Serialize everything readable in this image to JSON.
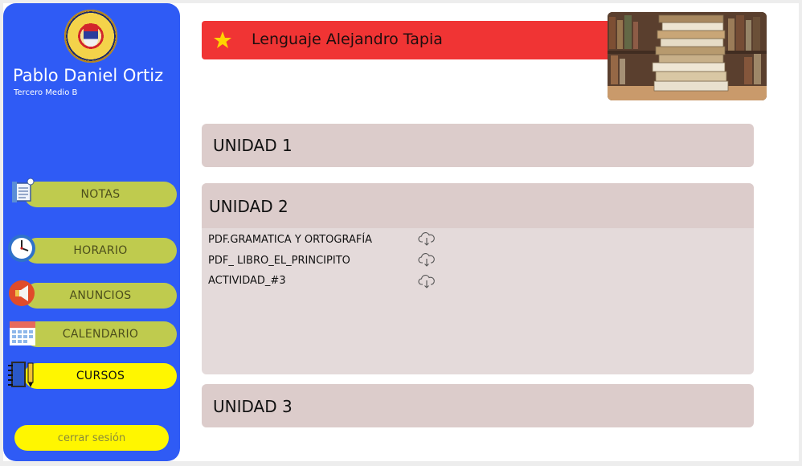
{
  "sidebar": {
    "user_name": "Pablo Daniel Ortiz",
    "user_grade": "Tercero Medio B",
    "nav": [
      {
        "label": "NOTAS",
        "icon": "notes-icon"
      },
      {
        "label": "HORARIO",
        "icon": "clock-icon"
      },
      {
        "label": "ANUNCIOS",
        "icon": "megaphone-icon"
      },
      {
        "label": "CALENDARIO",
        "icon": "calendar-icon"
      },
      {
        "label": "CURSOS",
        "icon": "notebook-icon",
        "active": true
      }
    ],
    "logout_label": "cerrar sesión",
    "logo_icon": "school-crest-logo"
  },
  "header": {
    "course_title": "Lenguaje Alejandro Tapia",
    "star_icon": "star-icon",
    "image_alt": "books-stack-image"
  },
  "units": [
    {
      "title": "UNIDAD 1"
    },
    {
      "title": "UNIDAD 2",
      "files": [
        {
          "name": "PDF.GRAMATICA Y ORTOGRAFÍA",
          "icon": "cloud-download-icon"
        },
        {
          "name": "PDF_ LIBRO_EL_PRINCIPITO",
          "icon": "cloud-download-icon"
        },
        {
          "name": "ACTIVIDAD_#3",
          "icon": "cloud-download-icon"
        }
      ]
    },
    {
      "title": "UNIDAD 3"
    }
  ],
  "colors": {
    "sidebar": "#2f5bf5",
    "nav_item": "#bfcb4e",
    "nav_active": "#fff600",
    "course_bar": "#f03434",
    "star": "#ffd400",
    "unit_bg": "#dccccb"
  }
}
